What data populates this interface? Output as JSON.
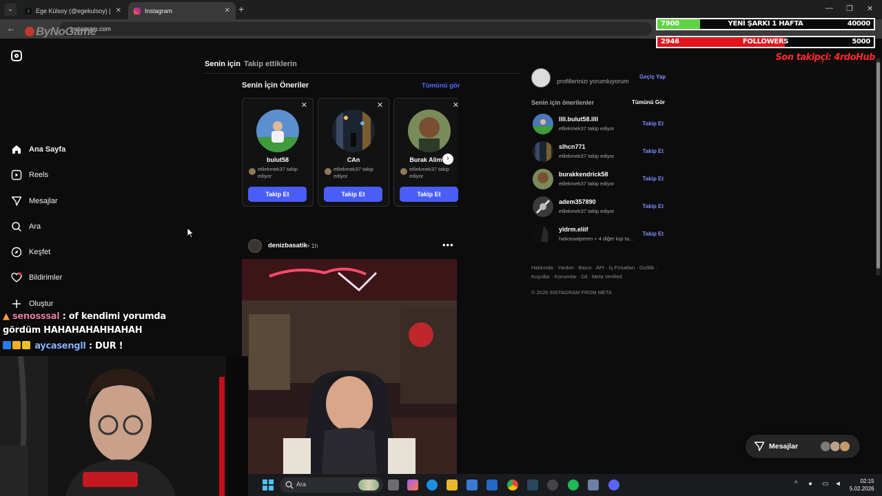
{
  "browser": {
    "tabs": [
      {
        "title": "Ege Külsoy (@egekulsoy) | TikTok",
        "favicon": "tiktok-icon"
      },
      {
        "title": "Instagram",
        "favicon": "instagram-icon"
      }
    ],
    "url": "instagram.com"
  },
  "overlay": {
    "logo_text": "ByNoGame",
    "song_goal": {
      "current": "7900",
      "label": "YENİ ŞARKI 1 HAFTA",
      "target": "40000",
      "fraction": 0.1975,
      "color": "#5fd443"
    },
    "followers_goal": {
      "current": "2946",
      "label": "FOLLOWERS",
      "target": "5000",
      "fraction": 0.5892,
      "color": "#e3141c"
    },
    "last_follower": "Son takipçi: 4rdoHub"
  },
  "sidebar": {
    "items": [
      {
        "label": "Ana Sayfa",
        "icon": "home-icon"
      },
      {
        "label": "Reels",
        "icon": "reels-icon"
      },
      {
        "label": "Mesajlar",
        "icon": "messages-icon"
      },
      {
        "label": "Ara",
        "icon": "search-icon"
      },
      {
        "label": "Keşfet",
        "icon": "explore-icon"
      },
      {
        "label": "Bildirimler",
        "icon": "heart-icon"
      },
      {
        "label": "Oluştur",
        "icon": "plus-icon"
      }
    ]
  },
  "feed": {
    "tabs": [
      "Senin için",
      "Takip ettiklerin"
    ],
    "suggestions_title": "Senin İçin Öneriler",
    "suggestions_see_all": "Tümünü gör",
    "suggestions": [
      {
        "name": "bulut58",
        "sub": "etliekmek37 takip ediyor",
        "button": "Takip Et"
      },
      {
        "name": "CAn",
        "sub": "etliekmek37 takip ediyor",
        "button": "Takip Et"
      },
      {
        "name": "Burak Alim",
        "sub": "etliekmek37 takip ediyor",
        "button": "Takip Et"
      }
    ],
    "post": {
      "user": "denizbasatik",
      "time": "• 1h"
    }
  },
  "right": {
    "profile_sub": "profillerinizi yorumluyorum",
    "switch": "Geçiş Yap",
    "suggested_title": "Senin için önerilenler",
    "see_all": "Tümünü Gör",
    "users": [
      {
        "name": "llll.bulut58.llll",
        "sub": "etliekmek37 takip ediyor",
        "action": "Takip Et"
      },
      {
        "name": "slhcn771",
        "sub": "etliekmek37 takip ediyor",
        "action": "Takip Et"
      },
      {
        "name": "burakkendrick58",
        "sub": "etliekmek37 takip ediyor",
        "action": "Takip Et"
      },
      {
        "name": "adem357890",
        "sub": "etliekmek37 takip ediyor",
        "action": "Takip Et"
      },
      {
        "name": "yldrm.eliif",
        "sub": "haticeaalperen + 4 diğer kişi ta...",
        "action": "Takip Et"
      }
    ],
    "footer_links": "Hakkında · Yardım · Basın · API · İş Fırsatları · Gizlilik · Koşullar · Konumlar · Dil · Meta Verified",
    "copyright": "© 2026 INSTAGRAM FROM META"
  },
  "messages_pill": {
    "label": "Mesajlar"
  },
  "chat": [
    {
      "user": "senosssal",
      "text": ": of kendimi yorumda gördüm HAHAHAHAHHAHAH"
    },
    {
      "user": "aycasengll",
      "text": ": DUR !"
    }
  ],
  "taskbar": {
    "search": "Ara",
    "time": "02:15",
    "date": "5.02.2026"
  }
}
